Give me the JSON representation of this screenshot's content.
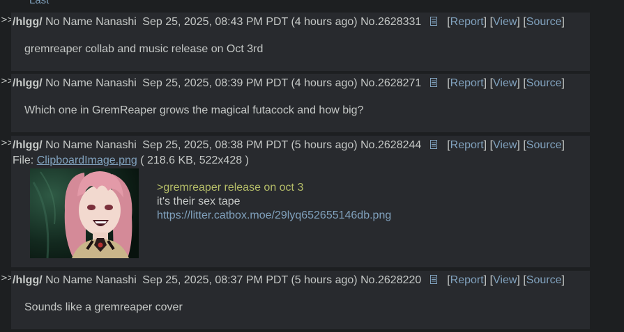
{
  "nav": {
    "last_label": "Last"
  },
  "posts": [
    {
      "board": "/hlgg/",
      "name": "No Name Nanashi",
      "date": "Sep 25, 2025, 08:43 PM PDT (4 hours ago)",
      "number": "No.2628331",
      "report": "Report",
      "view": "View",
      "source": "Source",
      "body": "gremreaper collab and music release on Oct 3rd"
    },
    {
      "board": "/hlgg/",
      "name": "No Name Nanashi",
      "date": "Sep 25, 2025, 08:39 PM PDT (4 hours ago)",
      "number": "No.2628271",
      "report": "Report",
      "view": "View",
      "source": "Source",
      "body": "Which one in GremReaper grows the magical futacock and how big?"
    },
    {
      "board": "/hlgg/",
      "name": "No Name Nanashi",
      "date": "Sep 25, 2025, 08:38 PM PDT (5 hours ago)",
      "number": "No.2628244",
      "report": "Report",
      "view": "View",
      "source": "Source",
      "file_prefix": "File:",
      "file_name": "ClipboardImage.png",
      "file_info": "( 218.6 KB, 522x428 )",
      "body_greentext": ">gremreaper release on oct 3",
      "body_line2": "it's their sex tape",
      "body_link": "https://litter.catbox.moe/29lyq652655146db.png"
    },
    {
      "board": "/hlgg/",
      "name": "No Name Nanashi",
      "date": "Sep 25, 2025, 08:37 PM PDT (5 hours ago)",
      "number": "No.2628220",
      "report": "Report",
      "view": "View",
      "source": "Source",
      "body": "Sounds like a gremreaper cover"
    }
  ],
  "glyphs": {
    "reply_arrow": ">>",
    "lbr": "[",
    "rbr": "]"
  },
  "colors": {
    "background": "#1d1f21",
    "post_background": "#282a2e",
    "text": "#c5c8c6",
    "link": "#81a2be",
    "greentext": "#b5bd68"
  }
}
